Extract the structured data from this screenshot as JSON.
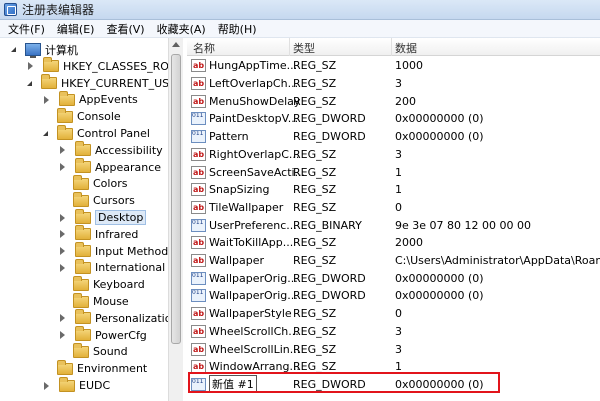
{
  "window": {
    "title": "注册表编辑器"
  },
  "menu": [
    "文件(F)",
    "编辑(E)",
    "查看(V)",
    "收藏夹(A)",
    "帮助(H)"
  ],
  "tree": [
    {
      "label": "计算机",
      "icon": "computer-icon",
      "expander": "expanded",
      "indent": 0
    },
    {
      "label": "HKEY_CLASSES_ROOT",
      "icon": "folder-icon",
      "expander": "collapsed",
      "indent": 1
    },
    {
      "label": "HKEY_CURRENT_USER",
      "icon": "folder-icon",
      "expander": "expanded",
      "indent": 1
    },
    {
      "label": "AppEvents",
      "icon": "folder-icon",
      "expander": "collapsed",
      "indent": 2
    },
    {
      "label": "Console",
      "icon": "folder-icon",
      "expander": "empty",
      "indent": 2
    },
    {
      "label": "Control Panel",
      "icon": "folder-icon",
      "expander": "expanded",
      "indent": 2
    },
    {
      "label": "Accessibility",
      "icon": "folder-icon",
      "expander": "collapsed",
      "indent": 3
    },
    {
      "label": "Appearance",
      "icon": "folder-icon",
      "expander": "collapsed",
      "indent": 3
    },
    {
      "label": "Colors",
      "icon": "folder-icon",
      "expander": "empty",
      "indent": 3
    },
    {
      "label": "Cursors",
      "icon": "folder-icon",
      "expander": "empty",
      "indent": 3
    },
    {
      "label": "Desktop",
      "icon": "folder-icon",
      "expander": "collapsed",
      "indent": 3,
      "selected": true
    },
    {
      "label": "Infrared",
      "icon": "folder-icon",
      "expander": "collapsed",
      "indent": 3
    },
    {
      "label": "Input Method",
      "icon": "folder-icon",
      "expander": "collapsed",
      "indent": 3
    },
    {
      "label": "International",
      "icon": "folder-icon",
      "expander": "collapsed",
      "indent": 3
    },
    {
      "label": "Keyboard",
      "icon": "folder-icon",
      "expander": "empty",
      "indent": 3
    },
    {
      "label": "Mouse",
      "icon": "folder-icon",
      "expander": "empty",
      "indent": 3
    },
    {
      "label": "Personalization",
      "icon": "folder-icon",
      "expander": "collapsed",
      "indent": 3
    },
    {
      "label": "PowerCfg",
      "icon": "folder-icon",
      "expander": "collapsed",
      "indent": 3
    },
    {
      "label": "Sound",
      "icon": "folder-icon",
      "expander": "empty",
      "indent": 3
    },
    {
      "label": "Environment",
      "icon": "folder-icon",
      "expander": "empty",
      "indent": 2
    },
    {
      "label": "EUDC",
      "icon": "folder-icon",
      "expander": "collapsed",
      "indent": 2
    }
  ],
  "columns": {
    "name": "名称",
    "type": "类型",
    "data": "数据"
  },
  "values": [
    {
      "name": "HungAppTime...",
      "type": "REG_SZ",
      "data": "1000",
      "icon": "string-value-icon"
    },
    {
      "name": "LeftOverlapCh...",
      "type": "REG_SZ",
      "data": "3",
      "icon": "string-value-icon"
    },
    {
      "name": "MenuShowDelay",
      "type": "REG_SZ",
      "data": "200",
      "icon": "string-value-icon"
    },
    {
      "name": "PaintDesktopV...",
      "type": "REG_DWORD",
      "data": "0x00000000 (0)",
      "icon": "dword-value-icon"
    },
    {
      "name": "Pattern",
      "type": "REG_DWORD",
      "data": "0x00000000 (0)",
      "icon": "dword-value-icon"
    },
    {
      "name": "RightOverlapC...",
      "type": "REG_SZ",
      "data": "3",
      "icon": "string-value-icon"
    },
    {
      "name": "ScreenSaveActi...",
      "type": "REG_SZ",
      "data": "1",
      "icon": "string-value-icon"
    },
    {
      "name": "SnapSizing",
      "type": "REG_SZ",
      "data": "1",
      "icon": "string-value-icon"
    },
    {
      "name": "TileWallpaper",
      "type": "REG_SZ",
      "data": "0",
      "icon": "string-value-icon"
    },
    {
      "name": "UserPreferenc...",
      "type": "REG_BINARY",
      "data": "9e 3e 07 80 12 00 00 00",
      "icon": "binary-value-icon"
    },
    {
      "name": "WaitToKillApp...",
      "type": "REG_SZ",
      "data": "2000",
      "icon": "string-value-icon"
    },
    {
      "name": "Wallpaper",
      "type": "REG_SZ",
      "data": "C:\\Users\\Administrator\\AppData\\Roaming",
      "icon": "string-value-icon"
    },
    {
      "name": "WallpaperOrig...",
      "type": "REG_DWORD",
      "data": "0x00000000 (0)",
      "icon": "dword-value-icon"
    },
    {
      "name": "WallpaperOrig...",
      "type": "REG_DWORD",
      "data": "0x00000000 (0)",
      "icon": "dword-value-icon"
    },
    {
      "name": "WallpaperStyle",
      "type": "REG_SZ",
      "data": "0",
      "icon": "string-value-icon"
    },
    {
      "name": "WheelScrollCh...",
      "type": "REG_SZ",
      "data": "3",
      "icon": "string-value-icon"
    },
    {
      "name": "WheelScrollLin...",
      "type": "REG_SZ",
      "data": "3",
      "icon": "string-value-icon"
    },
    {
      "name": "WindowArrang...",
      "type": "REG_SZ",
      "data": "1",
      "icon": "string-value-icon"
    },
    {
      "name": "新值 #1",
      "type": "REG_DWORD",
      "data": "0x00000000 (0)",
      "icon": "dword-value-icon",
      "editing": true
    }
  ],
  "colors": {
    "highlight_border": "#e2141b"
  }
}
